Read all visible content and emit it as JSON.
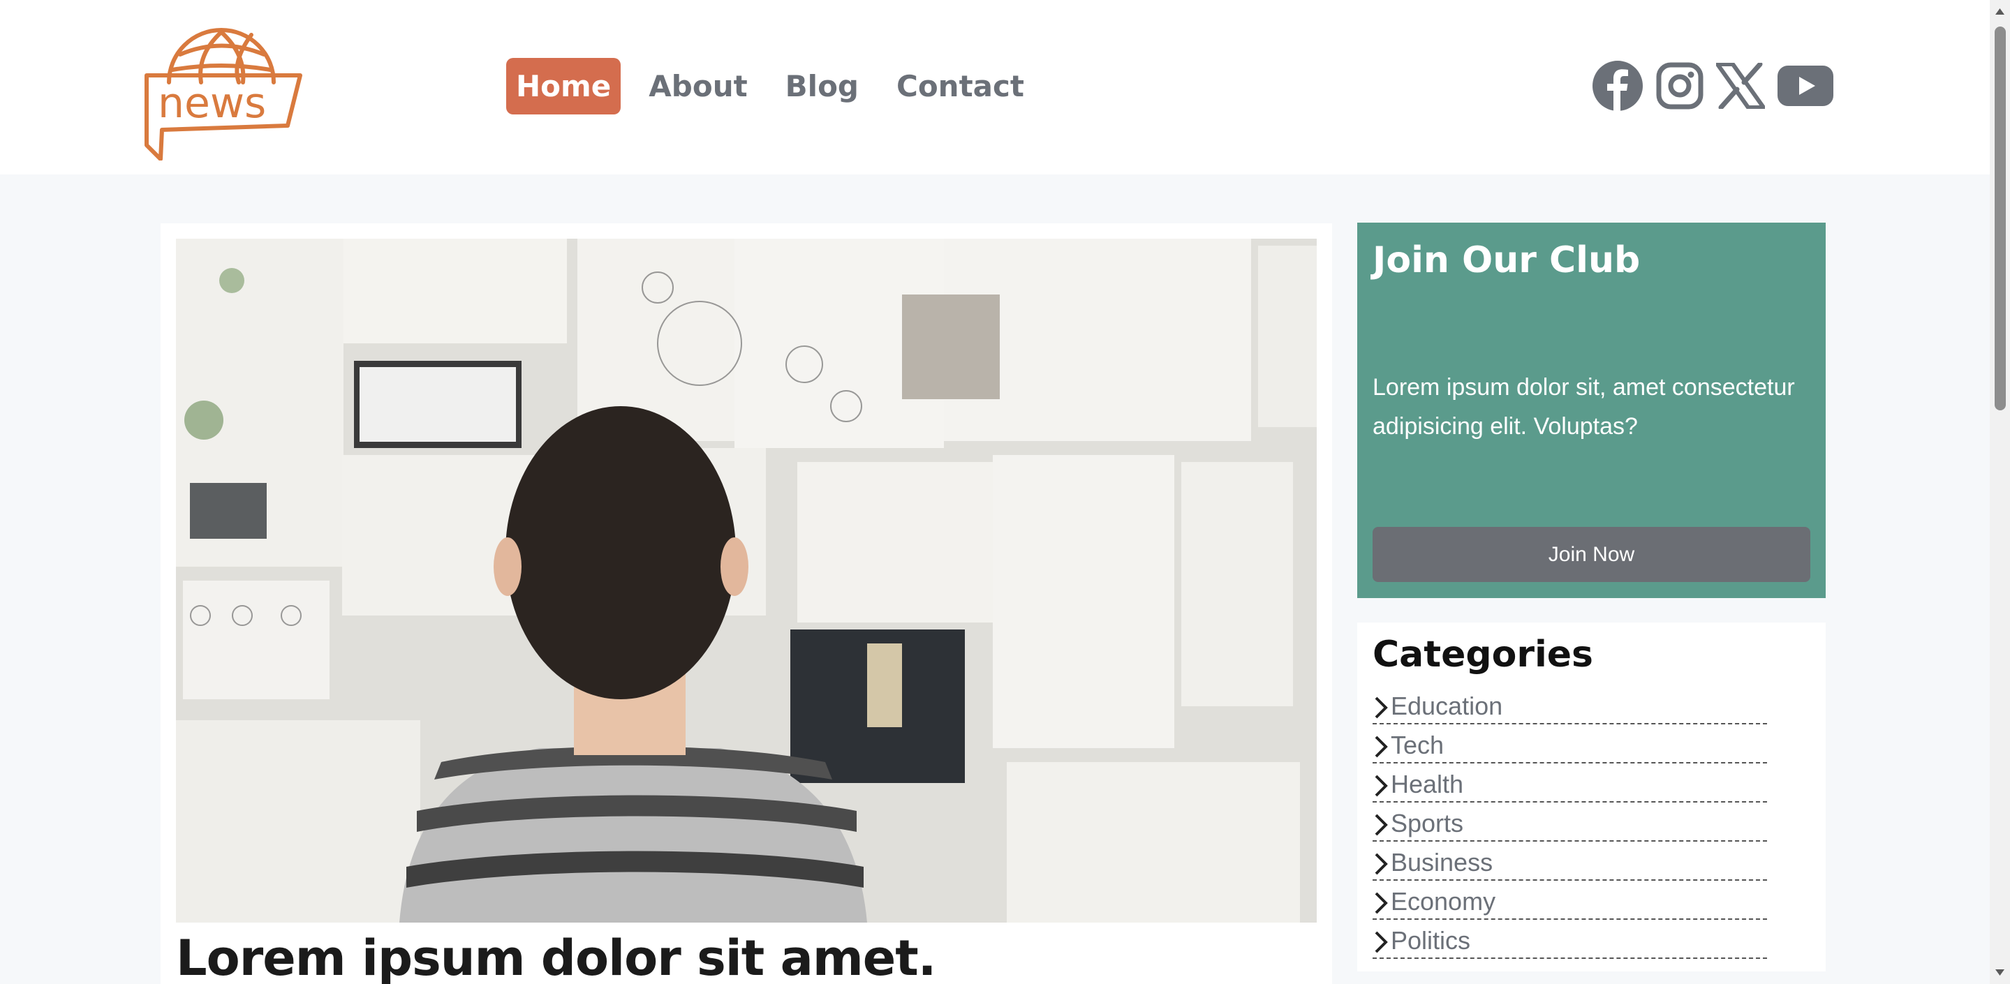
{
  "header": {
    "logo_text": "news",
    "nav": [
      {
        "label": "Home",
        "active": true
      },
      {
        "label": "About",
        "active": false
      },
      {
        "label": "Blog",
        "active": false
      },
      {
        "label": "Contact",
        "active": false
      }
    ],
    "social": [
      "facebook-icon",
      "instagram-icon",
      "x-icon",
      "youtube-icon"
    ]
  },
  "main": {
    "hero_image": "man-looking-at-moodboard-photo",
    "post_title": "Lorem ipsum dolor sit amet."
  },
  "sidebar": {
    "club": {
      "title": "Join Our Club",
      "text": "Lorem ipsum dolor sit, amet consectetur adipisicing elit. Voluptas?",
      "button": "Join Now"
    },
    "categories": {
      "title": "Categories",
      "items": [
        "Education",
        "Tech",
        "Health",
        "Sports",
        "Business",
        "Economy",
        "Politics"
      ]
    }
  },
  "colors": {
    "accent": "#d46d4e",
    "club_bg": "#5b9b8c",
    "nav_text": "#6b7078",
    "button_bg": "#6b6e74"
  }
}
